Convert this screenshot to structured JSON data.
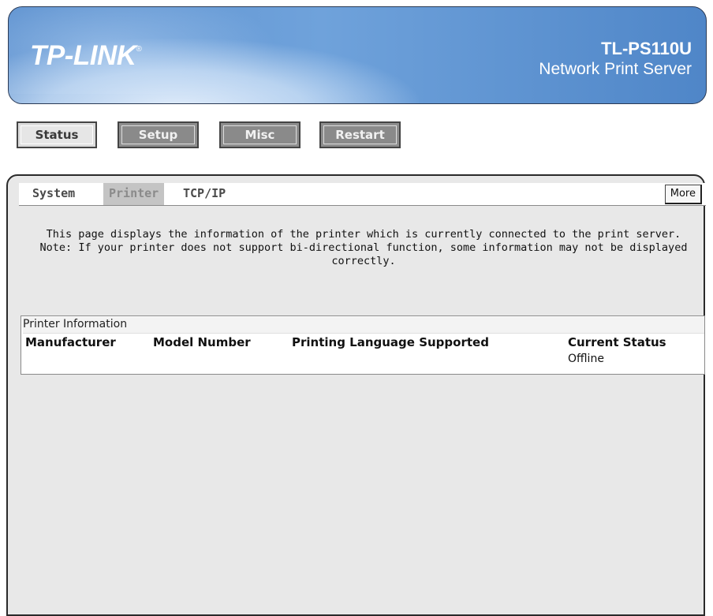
{
  "header": {
    "logo_text": "TP-LINK",
    "logo_mark": "®",
    "model_name": "TL-PS110U",
    "model_desc": "Network Print Server"
  },
  "topnav": [
    {
      "label": "Status"
    },
    {
      "label": "Setup"
    },
    {
      "label": "Misc"
    },
    {
      "label": "Restart"
    }
  ],
  "subnav": {
    "tabs": [
      {
        "label": "System"
      },
      {
        "label": "Printer"
      },
      {
        "label": "TCP/IP"
      }
    ],
    "active": "Printer",
    "more_label": "More"
  },
  "intro": {
    "line1": "This page displays the information of the printer which is currently connected to the print server.",
    "line2": "Note: If your printer does not support bi-directional function, some information may not be displayed correctly."
  },
  "printer_info": {
    "title": "Printer Information",
    "columns": [
      "Manufacturer",
      "Model Number",
      "Printing Language Supported",
      "Current Status"
    ],
    "values": [
      "",
      "",
      "",
      "Offline"
    ]
  },
  "colors": {
    "banner": "#5d91cf",
    "panel_bg": "#e8e8e8",
    "active_tab_bg": "#c4c4c4",
    "dark_button": "#8a8a8a"
  }
}
